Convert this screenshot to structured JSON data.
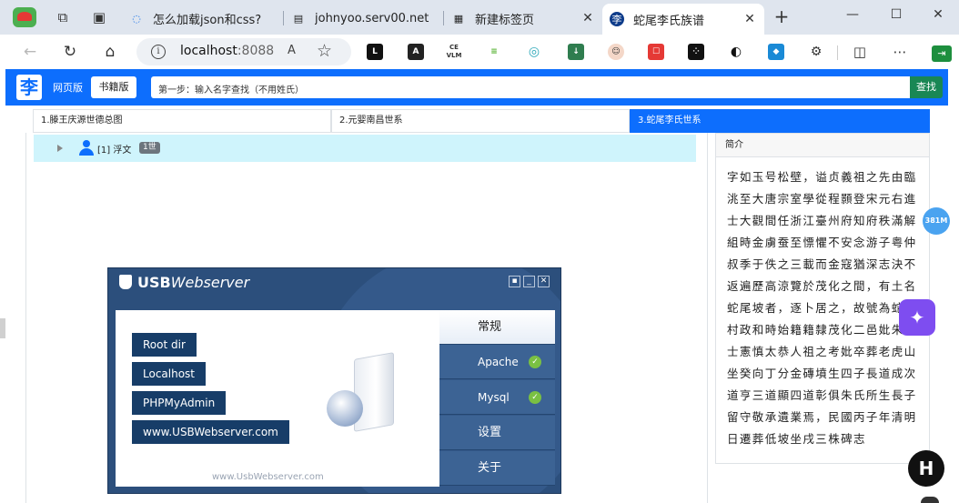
{
  "tabs": [
    {
      "title": "怎么加载json和css?",
      "active": false
    },
    {
      "title": "johnyoo.serv00.net",
      "active": false
    },
    {
      "title": "新建标签页",
      "active": false
    },
    {
      "title": "蛇尾李氏族谱",
      "active": true
    }
  ],
  "address": {
    "host": "localhost",
    "port": ":8088"
  },
  "extensions": [
    "L",
    "A",
    "CE VLM",
    "≡",
    "◎",
    "↓",
    "☺",
    "☐",
    "⁘",
    "◐",
    "◆",
    "⚙"
  ],
  "extension_badge": "3",
  "site": {
    "logo": "李",
    "web_version": "网页版",
    "book_version": "书籍版",
    "search_placeholder": "第一步：输入名字查找（不用姓氏）",
    "search_button": "查找"
  },
  "tree_tabs": [
    {
      "label": "1.滕王庆源世德总图",
      "active": false
    },
    {
      "label": "2.元婴南昌世系",
      "active": false
    },
    {
      "label": "3.蛇尾李氏世系",
      "active": true
    }
  ],
  "tree": {
    "name": "[1] 浮文",
    "generation": "1世"
  },
  "intro": {
    "title": "简介",
    "text": "字如玉号松壁，谥贞義祖之先由臨洮至大唐宗室學從程顥登宋元右進士大觀間任浙江臺州府知府秩滿解組時金虜蚕至慓懼不安念游子粤仲叔季于佚之三載而金寇猶深志決不返遍歷高涼覽於茂化之間，有土名蛇尾坡者，逐卜居之，故號為蛇尾村政和時始籍籍隸茂化二邑妣朱氏士憲慎太恭人祖之考妣卒葬老虎山坐癸向丁分金磚墳生四子長道成次道亨三道顯四道彰俱朱氏所生長子留守敬承遺業焉，民國丙子年清明日遷葬低坡坐戌三株碑志"
  },
  "floating": {
    "badge": "381M",
    "h_button": "H"
  },
  "usb": {
    "logo_main": "USB",
    "logo_sub": "Webserver",
    "buttons": [
      "Root dir",
      "Localhost",
      "PHPMyAdmin",
      "www.USBWebserver.com"
    ],
    "url": "www.UsbWebserver.com",
    "menu": [
      {
        "label": "常规",
        "active": true,
        "status": ""
      },
      {
        "label": "Apache",
        "active": false,
        "status": "ok"
      },
      {
        "label": "Mysql",
        "active": false,
        "status": "ok"
      },
      {
        "label": "设置",
        "active": false,
        "status": ""
      },
      {
        "label": "关于",
        "active": false,
        "status": ""
      }
    ]
  },
  "colors": {
    "primary": "#0d6efd",
    "success": "#198754",
    "tree_highlight": "#cff4fc",
    "usb_frame": "#2c4f7c",
    "usb_button": "#173d68"
  }
}
